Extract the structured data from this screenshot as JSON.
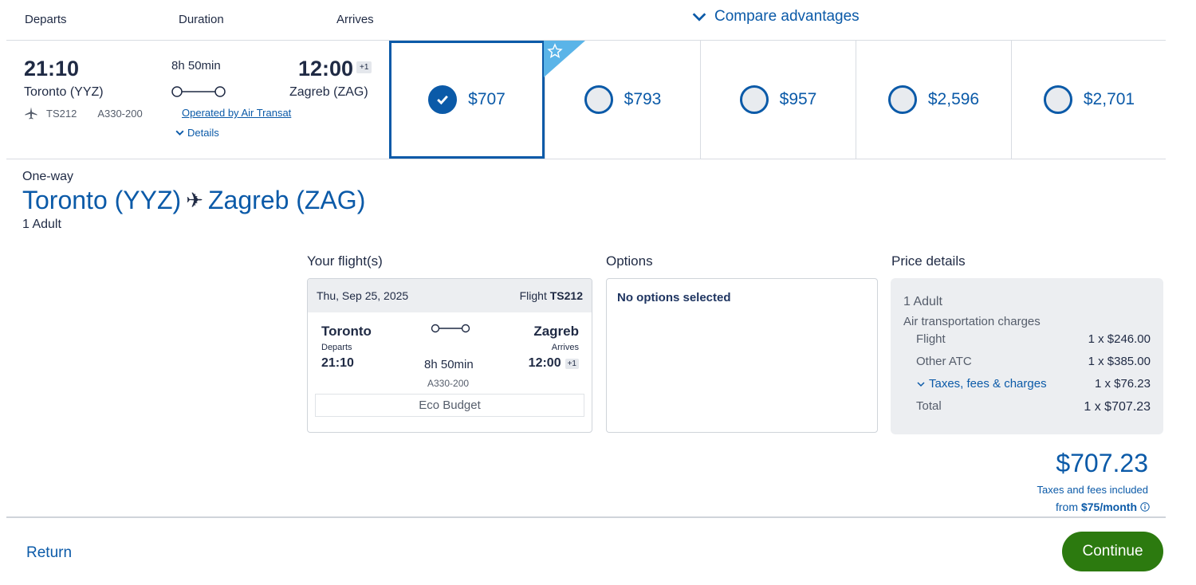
{
  "header": {
    "departs_label": "Departs",
    "duration_label": "Duration",
    "arrives_label": "Arrives",
    "compare_label": "Compare advantages"
  },
  "flight_row": {
    "departure_time": "21:10",
    "departure_city": "Toronto (YYZ)",
    "flight_number": "TS212",
    "aircraft": "A330-200",
    "duration": "8h 50min",
    "operated_by": "Operated by Air Transat",
    "details_label": "Details",
    "arrival_time": "12:00",
    "day_offset": "+1",
    "arrival_city": "Zagreb (ZAG)"
  },
  "fares": [
    {
      "price": "$707",
      "selected": true
    },
    {
      "price": "$793",
      "selected": false
    },
    {
      "price": "$957",
      "selected": false
    },
    {
      "price": "$2,596",
      "selected": false
    },
    {
      "price": "$2,701",
      "selected": false
    }
  ],
  "summary": {
    "trip_type": "One-way",
    "origin": "Toronto (YYZ)",
    "destination": "Zagreb (ZAG)",
    "passengers": "1 Adult"
  },
  "your_flights": {
    "title": "Your flight(s)",
    "date": "Thu, Sep 25, 2025",
    "flight_prefix": "Flight",
    "flight_number": "TS212",
    "from_city": "Toronto",
    "departs_label": "Departs",
    "dep_time": "21:10",
    "duration": "8h 50min",
    "aircraft": "A330-200",
    "to_city": "Zagreb",
    "arrives_label": "Arrives",
    "arr_time": "12:00",
    "day_offset": "+1",
    "cabin": "Eco Budget"
  },
  "options": {
    "title": "Options",
    "empty_text": "No options selected"
  },
  "price_details": {
    "title": "Price details",
    "passenger": "1 Adult",
    "section": "Air transportation charges",
    "rows": [
      {
        "label": "Flight",
        "value": "1 x $246.00"
      },
      {
        "label": "Other ATC",
        "value": "1 x $385.00"
      },
      {
        "label": "Taxes, fees & charges",
        "value": "1 x $76.23"
      },
      {
        "label": "Total",
        "value": "1 x $707.23"
      }
    ]
  },
  "totals": {
    "amount": "$707.23",
    "taxes_note": "Taxes and fees included",
    "from_prefix": "from",
    "monthly": "$75/month"
  },
  "footer": {
    "return_label": "Return",
    "continue_label": "Continue"
  },
  "colors": {
    "accent": "#0b5aa8",
    "continue": "#2c7a0f",
    "ribbon": "#5ab4e8"
  }
}
